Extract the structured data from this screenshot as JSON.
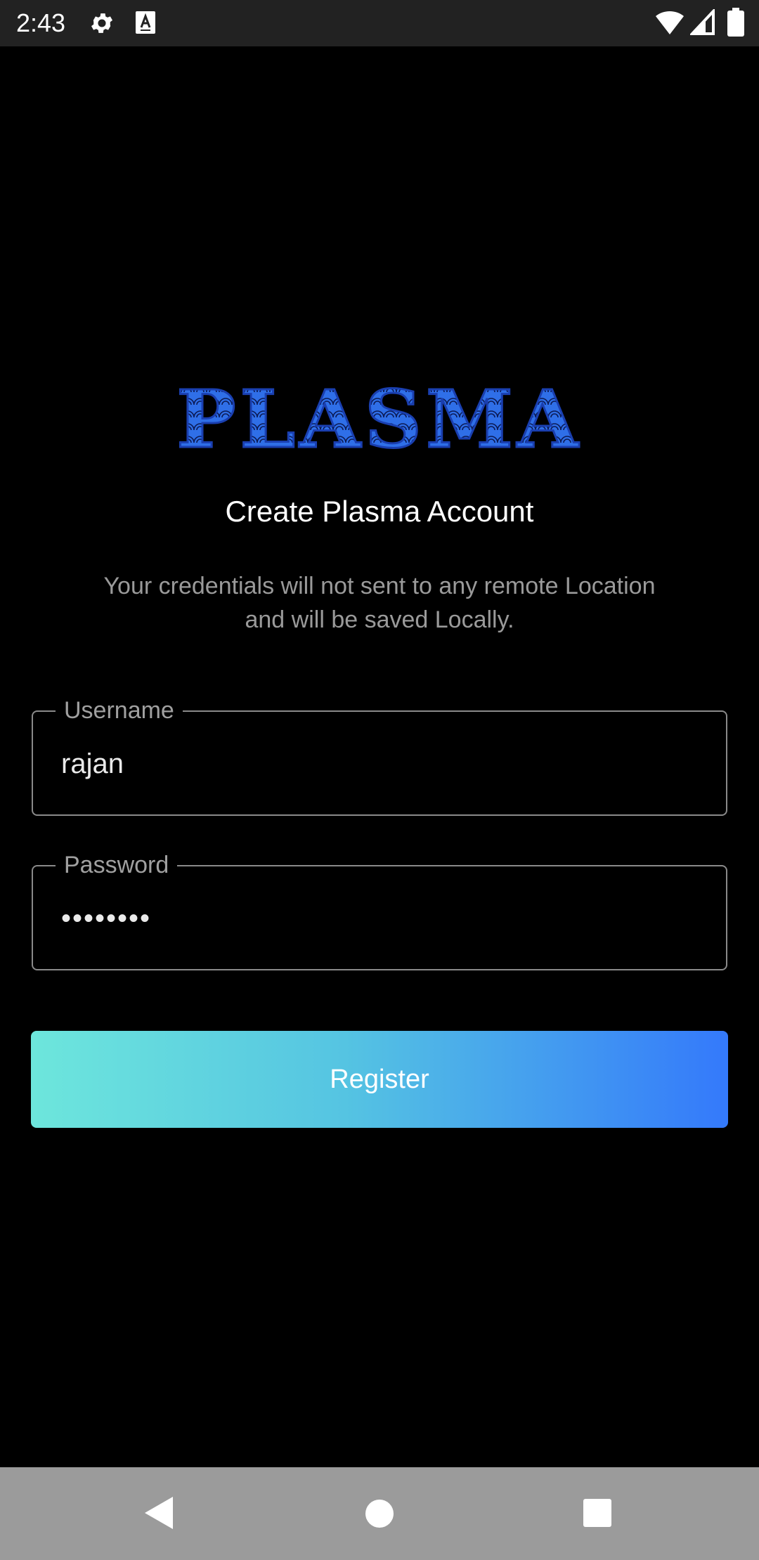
{
  "status_bar": {
    "time": "2:43",
    "icons": [
      "gear-icon",
      "font-a-icon",
      "wifi-icon",
      "signal-icon",
      "battery-icon"
    ]
  },
  "logo": {
    "text": "PLASMA",
    "color": "#2f6fe8"
  },
  "title": "Create Plasma Account",
  "subtitle_line1": "Your credentials will not sent to any remote Location",
  "subtitle_line2": "and will be saved Locally.",
  "form": {
    "username": {
      "label": "Username",
      "value": "rajan"
    },
    "password": {
      "label": "Password",
      "value": "••••••••"
    }
  },
  "register_button": {
    "label": "Register",
    "gradient_start": "#6de6dc",
    "gradient_end": "#3479fb"
  },
  "nav_bar": {
    "icons": [
      "back-icon",
      "home-icon",
      "recents-icon"
    ]
  }
}
